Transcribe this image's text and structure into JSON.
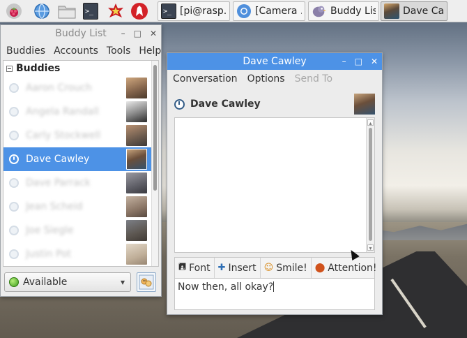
{
  "taskbar": {
    "tasks": [
      {
        "label": "[pi@rasp..."
      },
      {
        "label": "[Camera ..."
      },
      {
        "label": "Buddy List"
      },
      {
        "label": "Dave Ca..."
      }
    ]
  },
  "buddy_window": {
    "title": "Buddy List",
    "menu": [
      "Buddies",
      "Accounts",
      "Tools",
      "Help"
    ],
    "group": "Buddies",
    "buddies": [
      {
        "name": "Aaron Crouch"
      },
      {
        "name": "Angela Randall"
      },
      {
        "name": "Carly Stockwell"
      },
      {
        "name": "Dave Cawley"
      },
      {
        "name": "Dave Parrack"
      },
      {
        "name": "Jean Scheid"
      },
      {
        "name": "Joe Siegle"
      },
      {
        "name": "Justin Pot"
      }
    ],
    "status": "Available"
  },
  "chat_window": {
    "title": "Dave Cawley",
    "menu": [
      "Conversation",
      "Options",
      "Send To"
    ],
    "contact": "Dave Cawley",
    "toolbar": {
      "font": "Font",
      "insert": "Insert",
      "smile": "Smile!",
      "attention": "Attention!"
    },
    "entry_text": "Now then, all okay?"
  },
  "colors": {
    "accent": "#4d92e6",
    "titlebar_inactive_text": "#8a8a8a"
  }
}
